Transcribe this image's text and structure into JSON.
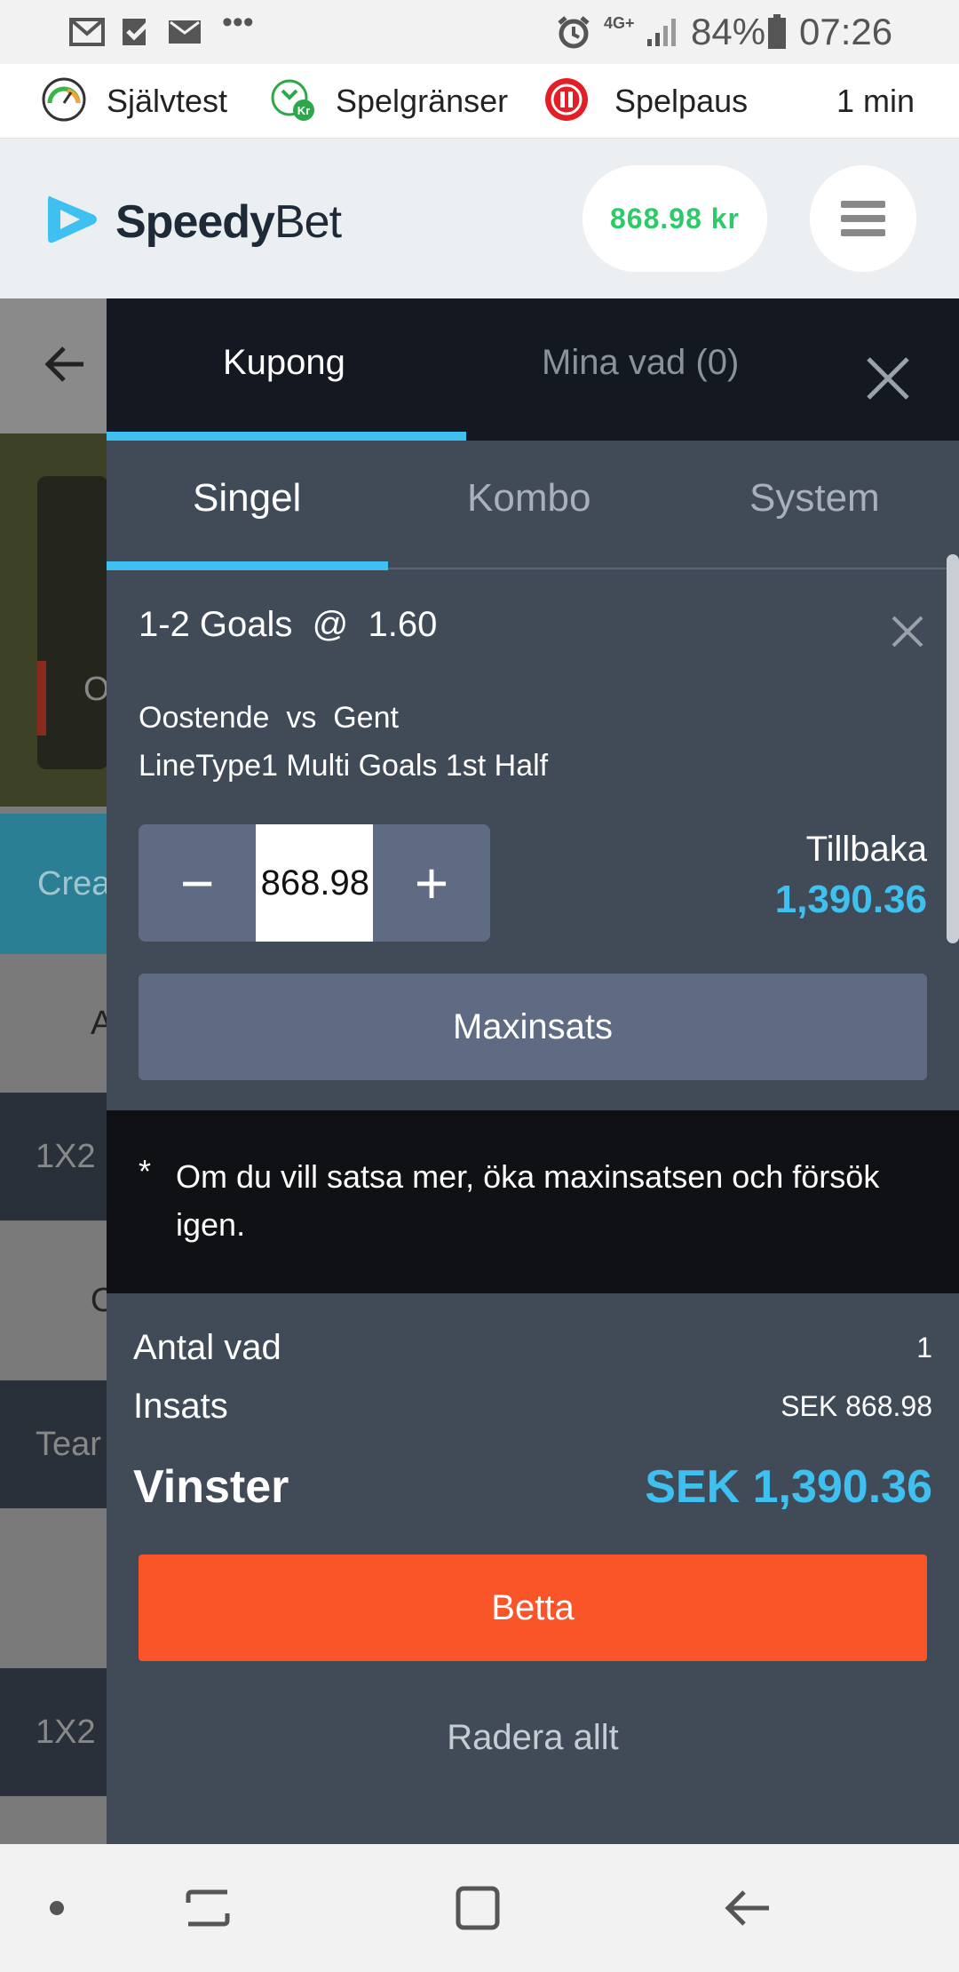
{
  "status_bar": {
    "battery": "84%",
    "time": "07:26",
    "network": "4G+",
    "overflow": "•••",
    "icons": [
      "gmail-icon",
      "check-icon",
      "mail-icon",
      "alarm-icon",
      "network-icon",
      "signal-icon",
      "battery-icon"
    ]
  },
  "rg_bar": {
    "items": [
      {
        "label": "Självtest",
        "icon": "gauge-icon"
      },
      {
        "label": "Spelgränser",
        "icon": "limits-icon"
      },
      {
        "label": "Spelpaus",
        "icon": "pause-icon"
      }
    ],
    "session_time": "1 min"
  },
  "header": {
    "logo_bold": "Speedy",
    "logo_regular": "Bet",
    "balance": "868.98 kr"
  },
  "background_page": {
    "rows": [
      "Crea",
      "A",
      "1X2",
      "O",
      "Tear",
      "1X2",
      "O"
    ]
  },
  "coupon": {
    "tabs": [
      {
        "label": "Kupong",
        "active": true
      },
      {
        "label": "Mina vad (0)",
        "active": false
      }
    ],
    "bet_types": [
      {
        "label": "Singel",
        "active": true
      },
      {
        "label": "Kombo",
        "active": false
      },
      {
        "label": "System",
        "active": false
      }
    ],
    "selection": {
      "title": "1-2 Goals  @  1.60",
      "match": "Oostende  vs  Gent",
      "market": "LineType1 Multi Goals 1st Half",
      "stake": "868.98",
      "minus": "−",
      "plus": "+",
      "return_label": "Tillbaka",
      "return_value": "1,390.36"
    },
    "max_button": "Maxinsats",
    "notice_star": "*",
    "notice": "Om du vill satsa mer, öka maxinsatsen och försök igen.",
    "summary": {
      "count_label": "Antal vad",
      "count_value": "1",
      "stake_label": "Insats",
      "stake_value": "SEK 868.98",
      "win_label": "Vinster",
      "win_value": "SEK 1,390.36"
    },
    "place_button": "Betta",
    "clear_all": "Radera allt"
  },
  "colors": {
    "accent": "#3ec1f0",
    "place_button": "#fa5429",
    "balance": "#2ec96a",
    "panel": "#414b58"
  }
}
